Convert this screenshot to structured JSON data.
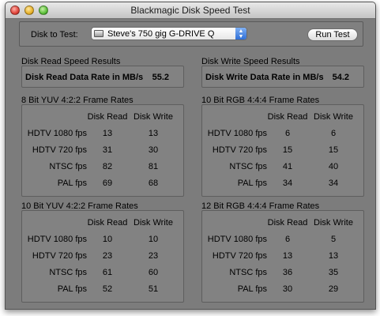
{
  "window": {
    "title": "Blackmagic Disk Speed Test"
  },
  "disk": {
    "label": "Disk to Test:",
    "selected": "Steve's 750 gig G-DRIVE Q"
  },
  "run_button": "Run Test",
  "read": {
    "section": "Disk Read Speed Results",
    "label": "Disk Read Data Rate in MB/s",
    "value": "55.2"
  },
  "write": {
    "section": "Disk Write Speed Results",
    "label": "Disk Write Data Rate in MB/s",
    "value": "54.2"
  },
  "groups": [
    {
      "title": "8 Bit YUV 4:2:2 Frame Rates",
      "col_read": "Disk Read",
      "col_write": "Disk Write",
      "rows": [
        {
          "label": "HDTV 1080 fps",
          "read": "13",
          "write": "13"
        },
        {
          "label": "HDTV 720 fps",
          "read": "31",
          "write": "30"
        },
        {
          "label": "NTSC fps",
          "read": "82",
          "write": "81"
        },
        {
          "label": "PAL fps",
          "read": "69",
          "write": "68"
        }
      ]
    },
    {
      "title": "10 Bit RGB 4:4:4 Frame Rates",
      "col_read": "Disk Read",
      "col_write": "Disk Write",
      "rows": [
        {
          "label": "HDTV 1080 fps",
          "read": "6",
          "write": "6"
        },
        {
          "label": "HDTV 720 fps",
          "read": "15",
          "write": "15"
        },
        {
          "label": "NTSC fps",
          "read": "41",
          "write": "40"
        },
        {
          "label": "PAL fps",
          "read": "34",
          "write": "34"
        }
      ]
    },
    {
      "title": "10 Bit YUV 4:2:2 Frame Rates",
      "col_read": "Disk Read",
      "col_write": "Disk Write",
      "rows": [
        {
          "label": "HDTV 1080 fps",
          "read": "10",
          "write": "10"
        },
        {
          "label": "HDTV 720 fps",
          "read": "23",
          "write": "23"
        },
        {
          "label": "NTSC fps",
          "read": "61",
          "write": "60"
        },
        {
          "label": "PAL fps",
          "read": "52",
          "write": "51"
        }
      ]
    },
    {
      "title": "12 Bit RGB 4:4:4 Frame Rates",
      "col_read": "Disk Read",
      "col_write": "Disk Write",
      "rows": [
        {
          "label": "HDTV 1080 fps",
          "read": "6",
          "write": "5"
        },
        {
          "label": "HDTV 720 fps",
          "read": "13",
          "write": "13"
        },
        {
          "label": "NTSC fps",
          "read": "36",
          "write": "35"
        },
        {
          "label": "PAL fps",
          "read": "30",
          "write": "29"
        }
      ]
    }
  ]
}
